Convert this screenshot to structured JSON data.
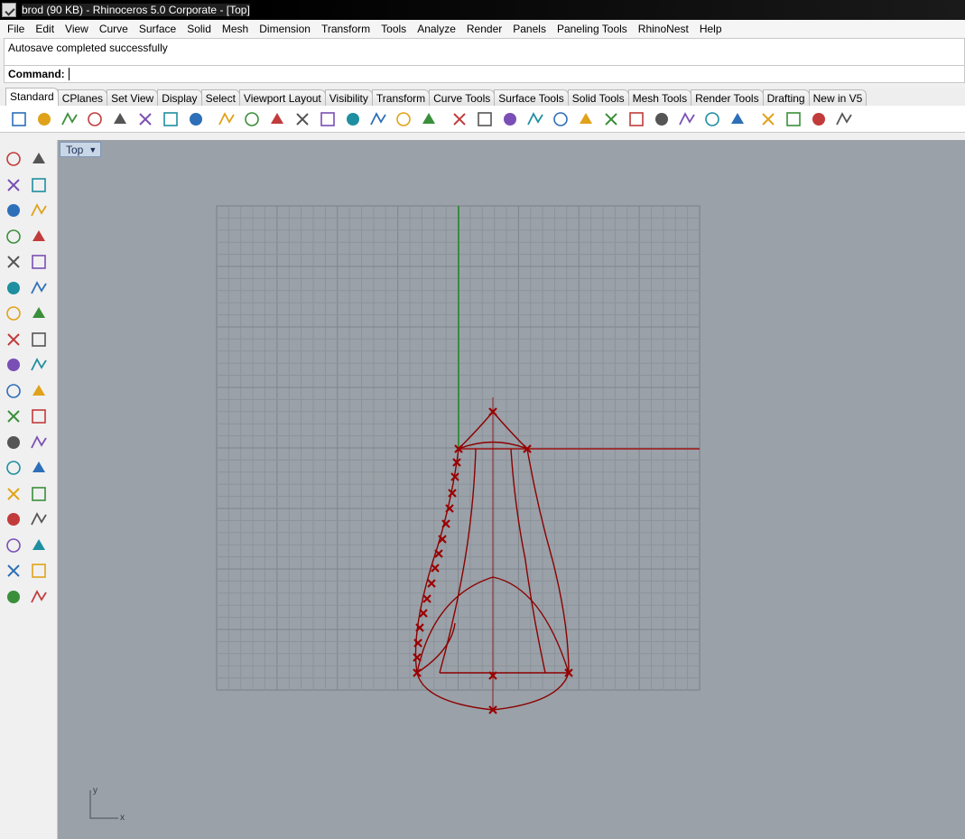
{
  "window": {
    "title": "brod (90 KB) - Rhinoceros  5.0 Corporate - [Top]"
  },
  "menubar": {
    "items": [
      "File",
      "Edit",
      "View",
      "Curve",
      "Surface",
      "Solid",
      "Mesh",
      "Dimension",
      "Transform",
      "Tools",
      "Analyze",
      "Render",
      "Panels",
      "Paneling Tools",
      "RhinoNest",
      "Help"
    ]
  },
  "history": {
    "text": "Autosave completed successfully"
  },
  "command": {
    "label": "Command:",
    "value": ""
  },
  "tabs": {
    "items": [
      "Standard",
      "CPlanes",
      "Set View",
      "Display",
      "Select",
      "Viewport Layout",
      "Visibility",
      "Transform",
      "Curve Tools",
      "Surface Tools",
      "Solid Tools",
      "Mesh Tools",
      "Render Tools",
      "Drafting",
      "New in V5"
    ],
    "active": "Standard"
  },
  "toolbar": {
    "icons": [
      "new-icon",
      "open-icon",
      "save-icon",
      "print-icon",
      "import-icon",
      "cut-icon",
      "copy-icon",
      "paste-icon",
      "undo-icon",
      "pan-icon",
      "rotate-view-icon",
      "zoom-dynamic-icon",
      "zoom-window-icon",
      "zoom-extents-icon",
      "zoom-selected-icon",
      "undo-view-icon",
      "viewport-layout-icon",
      "car-icon",
      "plane-icon",
      "cplane-icon",
      "named-view-icon",
      "light-icon",
      "lock-icon",
      "layer-icon",
      "color-wheel-icon",
      "render-sphere-icon",
      "shaded-sphere-icon",
      "rendered-sphere-icon",
      "material-icon",
      "options-icon",
      "gear-icon",
      "mesh-icon",
      "help-icon"
    ]
  },
  "leftbar": {
    "icons": [
      "select-arrow-icon",
      "point-icon",
      "polyline-icon",
      "curve-icon",
      "circle-icon",
      "ellipse-icon",
      "arc-icon",
      "rectangle-icon",
      "polygon-icon",
      "fillet-curve-icon",
      "surface-icon",
      "surface-edit-icon",
      "box-icon",
      "sphere-icon",
      "extrude-icon",
      "mesh-plane-icon",
      "gear-points-icon",
      "explode-icon",
      "split-icon",
      "trim-icon",
      "boolean-icon",
      "cluster-icon",
      "offset-icon",
      "blend-icon",
      "text-icon",
      "move-icon",
      "group-icon",
      "mirror-icon",
      "solid-box-icon",
      "dimension-icon",
      "array-icon",
      "align-icon",
      "block-icon",
      "check-icon",
      "shaded-icon",
      "paint-icon"
    ]
  },
  "viewport": {
    "name": "Top",
    "axis_x": "x",
    "axis_y": "y"
  }
}
